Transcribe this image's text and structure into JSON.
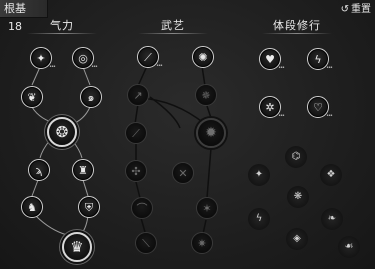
{
  "header": {
    "root_label": "根基",
    "root_value": "18",
    "reset_label": "重置",
    "reset_icon": "undo-icon"
  },
  "columns": [
    {
      "id": "qili",
      "title": "气力"
    },
    {
      "id": "wuyi",
      "title": "武艺"
    },
    {
      "id": "tiduan",
      "title": "体段修行"
    }
  ],
  "nodes": {
    "qili": [
      {
        "name": "skill-fan-icon",
        "glyph": "✦",
        "state": "lit",
        "dots": true
      },
      {
        "name": "skill-swirl-icon",
        "glyph": "◎",
        "state": "lit",
        "dots": true
      },
      {
        "name": "skill-feather-icon",
        "glyph": "❦",
        "state": "lit"
      },
      {
        "name": "skill-whirlwind-icon",
        "glyph": "๑",
        "state": "lit"
      },
      {
        "name": "skill-core-icon",
        "glyph": "❂",
        "state": "big-lit"
      },
      {
        "name": "skill-whip-icon",
        "glyph": "ϡ",
        "state": "lit"
      },
      {
        "name": "skill-helmet-icon",
        "glyph": "♜",
        "state": "lit"
      },
      {
        "name": "skill-tiger-icon",
        "glyph": "♞",
        "state": "lit"
      },
      {
        "name": "skill-armor-icon",
        "glyph": "⛨",
        "state": "lit"
      },
      {
        "name": "skill-warrior-icon",
        "glyph": "♛",
        "state": "big-lit"
      }
    ],
    "wuyi": [
      {
        "name": "skill-spear-icon",
        "glyph": "⟋",
        "state": "lit",
        "dots": true
      },
      {
        "name": "skill-burst-icon",
        "glyph": "✺",
        "state": "lit"
      },
      {
        "name": "skill-thrust-icon",
        "glyph": "↗",
        "state": "dim"
      },
      {
        "name": "skill-vortex-icon",
        "glyph": "✵",
        "state": "dim"
      },
      {
        "name": "skill-slash-icon",
        "glyph": "⟋",
        "state": "dim"
      },
      {
        "name": "skill-sunburst-icon",
        "glyph": "✹",
        "state": "big-dim"
      },
      {
        "name": "skill-spin-icon",
        "glyph": "✣",
        "state": "dim"
      },
      {
        "name": "skill-cross-icon",
        "glyph": "✕",
        "state": "dim"
      },
      {
        "name": "skill-arc-icon",
        "glyph": "⌒",
        "state": "dim"
      },
      {
        "name": "skill-flare-icon",
        "glyph": "✶",
        "state": "dim"
      },
      {
        "name": "skill-blade-icon",
        "glyph": "⟍",
        "state": "dim"
      },
      {
        "name": "skill-shatter-icon",
        "glyph": "✷",
        "state": "dim"
      }
    ],
    "tiduan": [
      {
        "name": "body-heart-icon",
        "glyph": "♥",
        "state": "lit",
        "dots": true
      },
      {
        "name": "body-lightning-icon",
        "glyph": "ϟ",
        "state": "lit",
        "dots": true
      },
      {
        "name": "body-sun-icon",
        "glyph": "✲",
        "state": "lit",
        "dots": true
      },
      {
        "name": "body-heartbeat-icon",
        "glyph": "♡",
        "state": "lit",
        "dots": true
      },
      {
        "name": "body-ring-icon",
        "glyph": "⌬",
        "state": "shard"
      },
      {
        "name": "body-mark-icon",
        "glyph": "✦",
        "state": "shard"
      },
      {
        "name": "body-fist-icon",
        "glyph": "❖",
        "state": "shard"
      },
      {
        "name": "body-scale-icon",
        "glyph": "❋",
        "state": "shard"
      },
      {
        "name": "body-bolt-icon",
        "glyph": "ϟ",
        "state": "shard"
      },
      {
        "name": "body-leaf-icon",
        "glyph": "❧",
        "state": "shard"
      },
      {
        "name": "body-gem-icon",
        "glyph": "◈",
        "state": "shard"
      },
      {
        "name": "body-flame-icon",
        "glyph": "☙",
        "state": "shard"
      }
    ]
  },
  "colors": {
    "background": "#1f1f1f",
    "lit_ring": "#cfcfcf",
    "dim_ring": "#3a3a3a",
    "line_lit": "#9a9a9a",
    "line_dim": "#1a1a1a"
  }
}
